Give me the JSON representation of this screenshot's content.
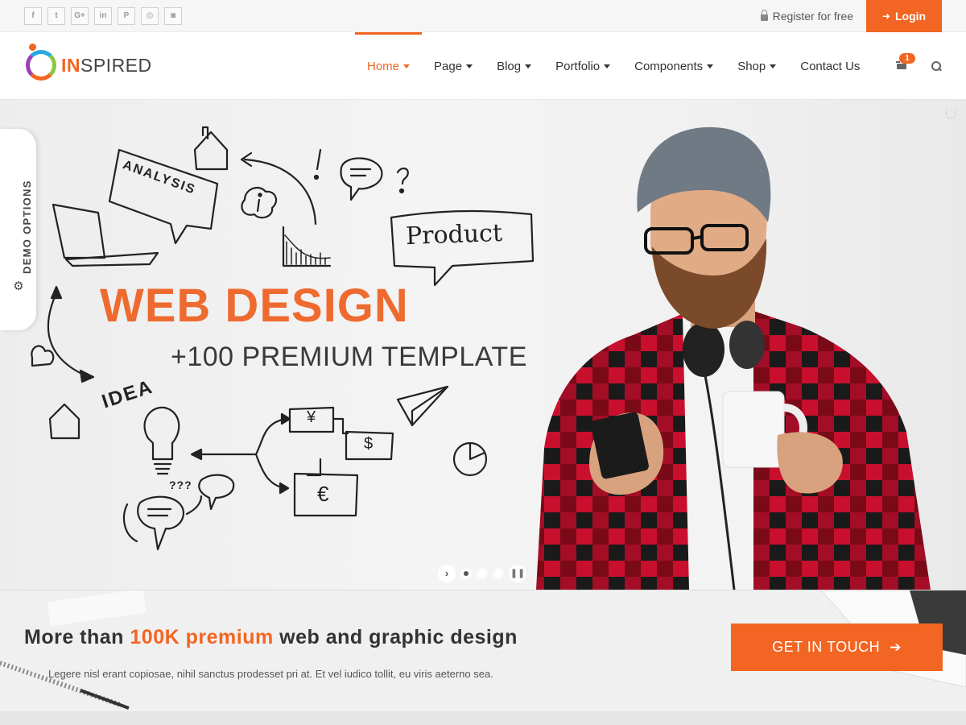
{
  "topbar": {
    "socials": [
      {
        "icon": "facebook-icon",
        "glyph": "f"
      },
      {
        "icon": "twitter-icon",
        "glyph": "t"
      },
      {
        "icon": "google-plus-icon",
        "glyph": "G+"
      },
      {
        "icon": "linkedin-icon",
        "glyph": "in"
      },
      {
        "icon": "pinterest-icon",
        "glyph": "P"
      },
      {
        "icon": "dribbble-icon",
        "glyph": "◎"
      },
      {
        "icon": "instagram-icon",
        "glyph": "◙"
      }
    ],
    "register_label": "Register for free",
    "login_label": "Login"
  },
  "header": {
    "logo_accent": "IN",
    "logo_rest": "SPIRED",
    "nav": [
      "Home",
      "Page",
      "Blog",
      "Portfolio",
      "Components",
      "Shop",
      "Contact Us"
    ],
    "active_nav": "Home",
    "cart_count": "1"
  },
  "hero": {
    "title": "WEB DESIGN",
    "subtitle": "+100 PREMIUM TEMPLATE",
    "doodle_words": {
      "analysis": "ANALYSIS",
      "product": "Product",
      "idea": "IDEA",
      "yen": "¥",
      "dollar": "$",
      "euro": "€",
      "question": "???"
    },
    "slide_count": 3,
    "active_slide": 1
  },
  "demo_options": {
    "label": "DEMO OPTIONS"
  },
  "cta": {
    "title_before": "More than ",
    "title_highlight": "100K premium",
    "title_after": " web and graphic design",
    "description": "Legere nisl erant copiosae, nihil sanctus prodesset pri at. Et vel iudico tollit, eu viris aeterno sea.",
    "button_label": "GET IN TOUCH"
  },
  "colors": {
    "accent": "#f26522",
    "text": "#333333"
  }
}
